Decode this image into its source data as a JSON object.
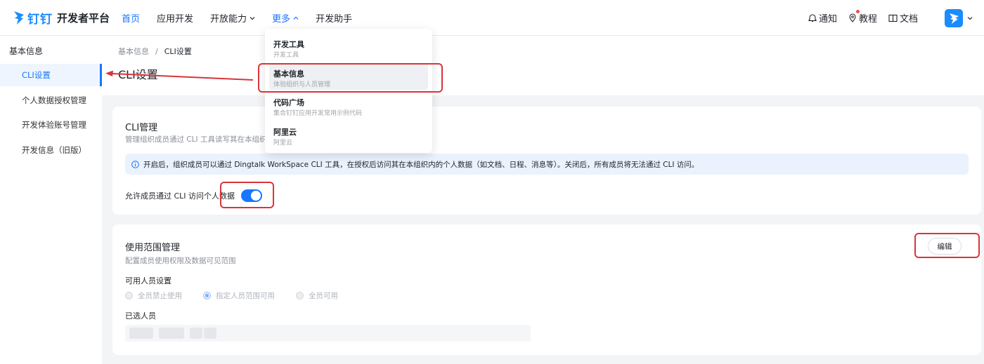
{
  "header": {
    "logo_brand": "钉钉",
    "logo_product": "开发者平台",
    "nav": [
      {
        "label": "首页",
        "active": true
      },
      {
        "label": "应用开发"
      },
      {
        "label": "开放能力"
      },
      {
        "label": "更多"
      },
      {
        "label": "开发助手"
      }
    ],
    "right": {
      "notify": "通知",
      "tutorial": "教程",
      "docs": "文档"
    },
    "colors": {
      "accent": "#1677ff",
      "annotation": "#d9343a"
    }
  },
  "sidebar": {
    "group_title": "基本信息",
    "items": [
      {
        "label": "CLI设置",
        "active": true
      },
      {
        "label": "个人数据授权管理"
      },
      {
        "label": "开发体验账号管理"
      },
      {
        "label": "开发信息（旧版）"
      }
    ]
  },
  "page": {
    "breadcrumb": [
      "基本信息",
      "CLI设置"
    ],
    "breadcrumb_sep": "/",
    "title": "CLI设置"
  },
  "cli_card": {
    "title": "CLI管理",
    "desc": "管理组织成员通过 CLI 工具读写其在本组织",
    "alert": "开启后，组织成员可以通过 Dingtalk WorkSpace CLI 工具，在授权后访问其在本组织内的个人数据（如文档、日程、消息等）。关闭后，所有成员将无法通过 CLI 访问。",
    "toggle_label": "允许成员通过 CLI 访问个人数据",
    "toggle_on": true
  },
  "scope_card": {
    "title": "使用范围管理",
    "desc": "配置成员使用权限及数据可见范围",
    "edit_label": "编辑",
    "user_settings_label": "可用人员设置",
    "radios": [
      {
        "label": "全员禁止使用",
        "checked": false
      },
      {
        "label": "指定人员范围可用",
        "checked": true
      },
      {
        "label": "全员可用",
        "checked": false
      }
    ],
    "selected_label": "已选人员"
  },
  "dropdown": {
    "items": [
      {
        "name": "开发工具",
        "desc": "开发工具"
      },
      {
        "name": "基本信息",
        "desc": "体验组织与人员管理",
        "hover": true
      },
      {
        "name": "代码广场",
        "desc": "集合钉钉应用开发常用示例代码"
      },
      {
        "name": "阿里云",
        "desc": "阿里云"
      }
    ]
  }
}
